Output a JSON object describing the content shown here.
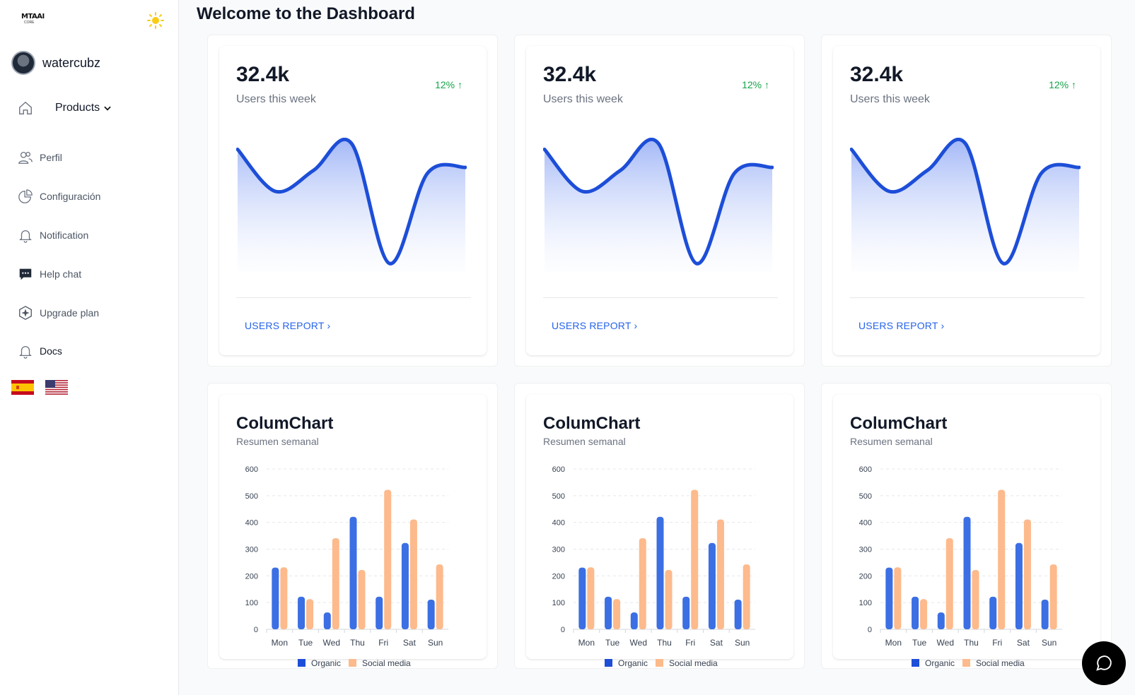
{
  "sidebar": {
    "logo": {
      "text": "MTAAI",
      "sub": "CORE"
    },
    "user": {
      "name": "watercubz"
    },
    "products_label": "Products",
    "items": [
      {
        "label": "Perfil",
        "icon": "users-icon"
      },
      {
        "label": "Configuración",
        "icon": "pie-chart-icon"
      },
      {
        "label": "Notification",
        "icon": "bell-icon"
      },
      {
        "label": "Help chat",
        "icon": "chat-bubble-icon"
      },
      {
        "label": "Upgrade plan",
        "icon": "sparkle-badge-icon"
      },
      {
        "label": "Docs",
        "icon": "bell-icon"
      }
    ],
    "flags": [
      "spain-flag",
      "usa-flag"
    ]
  },
  "header": {
    "title": "Welcome to the Dashboard"
  },
  "stats": [
    {
      "value": "32.4k",
      "label": "Users this week",
      "change": "12%",
      "link": "USERS REPORT"
    },
    {
      "value": "32.4k",
      "label": "Users this week",
      "change": "12%",
      "link": "USERS REPORT"
    },
    {
      "value": "32.4k",
      "label": "Users this week",
      "change": "12%",
      "link": "USERS REPORT"
    }
  ],
  "columns": [
    {
      "title": "ColumChart",
      "subtitle": "Resumen semanal"
    },
    {
      "title": "ColumChart",
      "subtitle": "Resumen semanal"
    },
    {
      "title": "ColumChart",
      "subtitle": "Resumen semanal"
    }
  ],
  "colors": {
    "accent": "#2563eb",
    "organic": "#1d4ed8",
    "social": "#fdba8c",
    "positive": "#16a34a"
  },
  "chart_data": [
    {
      "type": "area",
      "x": [
        0,
        1,
        2,
        3,
        4,
        5,
        6
      ],
      "values": [
        3700,
        3000,
        3350,
        3800,
        1800,
        3300,
        3400
      ],
      "title": "",
      "grid": false
    },
    {
      "type": "area",
      "x": [
        0,
        1,
        2,
        3,
        4,
        5,
        6
      ],
      "values": [
        3700,
        3000,
        3350,
        3800,
        1800,
        3300,
        3400
      ],
      "title": "",
      "grid": false
    },
    {
      "type": "area",
      "x": [
        0,
        1,
        2,
        3,
        4,
        5,
        6
      ],
      "values": [
        3700,
        3000,
        3350,
        3800,
        1800,
        3300,
        3400
      ],
      "title": "",
      "grid": false
    },
    {
      "type": "bar",
      "title": "ColumChart",
      "categories": [
        "Mon",
        "Tue",
        "Wed",
        "Thu",
        "Fri",
        "Sat",
        "Sun"
      ],
      "series": [
        {
          "name": "Organic",
          "values": [
            231,
            122,
            63,
            421,
            122,
            323,
            111
          ]
        },
        {
          "name": "Social media",
          "values": [
            232,
            113,
            341,
            222,
            522,
            411,
            243
          ]
        }
      ],
      "ylim": [
        0,
        600
      ],
      "yticks": [
        0,
        100,
        200,
        300,
        400,
        500,
        600
      ],
      "legend": "bottom",
      "grid": true
    },
    {
      "type": "bar",
      "title": "ColumChart",
      "categories": [
        "Mon",
        "Tue",
        "Wed",
        "Thu",
        "Fri",
        "Sat",
        "Sun"
      ],
      "series": [
        {
          "name": "Organic",
          "values": [
            231,
            122,
            63,
            421,
            122,
            323,
            111
          ]
        },
        {
          "name": "Social media",
          "values": [
            232,
            113,
            341,
            222,
            522,
            411,
            243
          ]
        }
      ],
      "ylim": [
        0,
        600
      ],
      "yticks": [
        0,
        100,
        200,
        300,
        400,
        500,
        600
      ],
      "legend": "bottom",
      "grid": true
    },
    {
      "type": "bar",
      "title": "ColumChart",
      "categories": [
        "Mon",
        "Tue",
        "Wed",
        "Thu",
        "Fri",
        "Sat",
        "Sun"
      ],
      "series": [
        {
          "name": "Organic",
          "values": [
            231,
            122,
            63,
            421,
            122,
            323,
            111
          ]
        },
        {
          "name": "Social media",
          "values": [
            232,
            113,
            341,
            222,
            522,
            411,
            243
          ]
        }
      ],
      "ylim": [
        0,
        600
      ],
      "yticks": [
        0,
        100,
        200,
        300,
        400,
        500,
        600
      ],
      "legend": "bottom",
      "grid": true
    }
  ]
}
